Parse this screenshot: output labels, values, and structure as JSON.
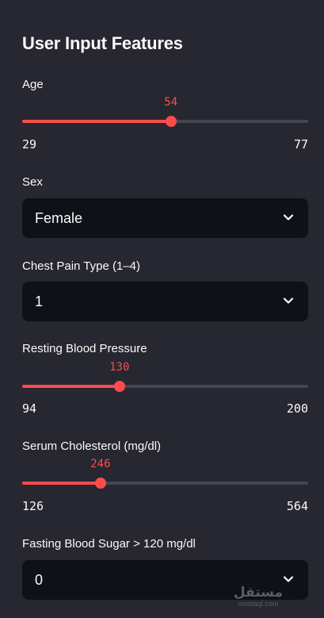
{
  "sidebar": {
    "title": "User Input Features",
    "age": {
      "label": "Age",
      "value": "54",
      "min": "29",
      "max": "77",
      "fraction": 0.52
    },
    "sex": {
      "label": "Sex",
      "value": "Female"
    },
    "chest_pain": {
      "label": "Chest Pain Type (1–4)",
      "value": "1"
    },
    "resting_bp": {
      "label": "Resting Blood Pressure",
      "value": "130",
      "min": "94",
      "max": "200",
      "fraction": 0.34
    },
    "cholesterol": {
      "label": "Serum Cholesterol (mg/dl)",
      "value": "246",
      "min": "126",
      "max": "564",
      "fraction": 0.274
    },
    "fasting_bs": {
      "label": "Fasting Blood Sugar > 120 mg/dl",
      "value": "0"
    }
  },
  "watermark": {
    "arabic": "مستقل",
    "latin": "mostaql.com"
  },
  "colors": {
    "accent": "#ff4b4b",
    "background": "#262730",
    "input_bg": "#0e1117",
    "track": "#45464f"
  },
  "icons": {
    "dropdown": "chevron-down-icon"
  }
}
